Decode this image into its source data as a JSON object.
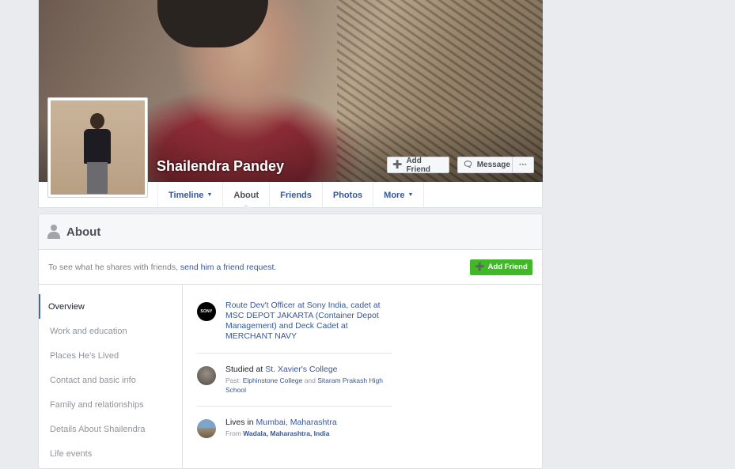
{
  "profile": {
    "name": "Shailendra Pandey",
    "buttons": {
      "add_friend": "Add Friend",
      "message": "Message",
      "more": "···"
    }
  },
  "tabs": [
    {
      "label": "Timeline",
      "has_caret": true
    },
    {
      "label": "About",
      "active": true
    },
    {
      "label": "Friends"
    },
    {
      "label": "Photos"
    },
    {
      "label": "More",
      "has_caret": true
    }
  ],
  "about": {
    "title": "About",
    "friend_note_prefix": "To see what he shares with friends, ",
    "friend_note_link": "send him a friend request.",
    "add_friend": "Add Friend",
    "sidebar": [
      "Overview",
      "Work and education",
      "Places He's Lived",
      "Contact and basic info",
      "Family and relationships",
      "Details About Shailendra",
      "Life events"
    ],
    "entries": {
      "work": {
        "icon_text": "SONY",
        "text": "Route Dev't Officer at Sony India, cadet at MSC DEPOT JAKARTA (Container Depot Management) and Deck Cadet at MERCHANT NAVY"
      },
      "education": {
        "prefix": "Studied at ",
        "school": "St. Xavier's College",
        "past_label": "Past: ",
        "past_1": "Elphinstone College",
        "and": " and ",
        "past_2": "Sitaram Prakash High School"
      },
      "location": {
        "prefix": "Lives in ",
        "city": "Mumbai, Maharashtra",
        "from_label": "From ",
        "from": "Wadala, Maharashtra, India"
      }
    }
  },
  "colors": {
    "link": "#365899",
    "green": "#42b72a",
    "background": "#e9ebee"
  }
}
